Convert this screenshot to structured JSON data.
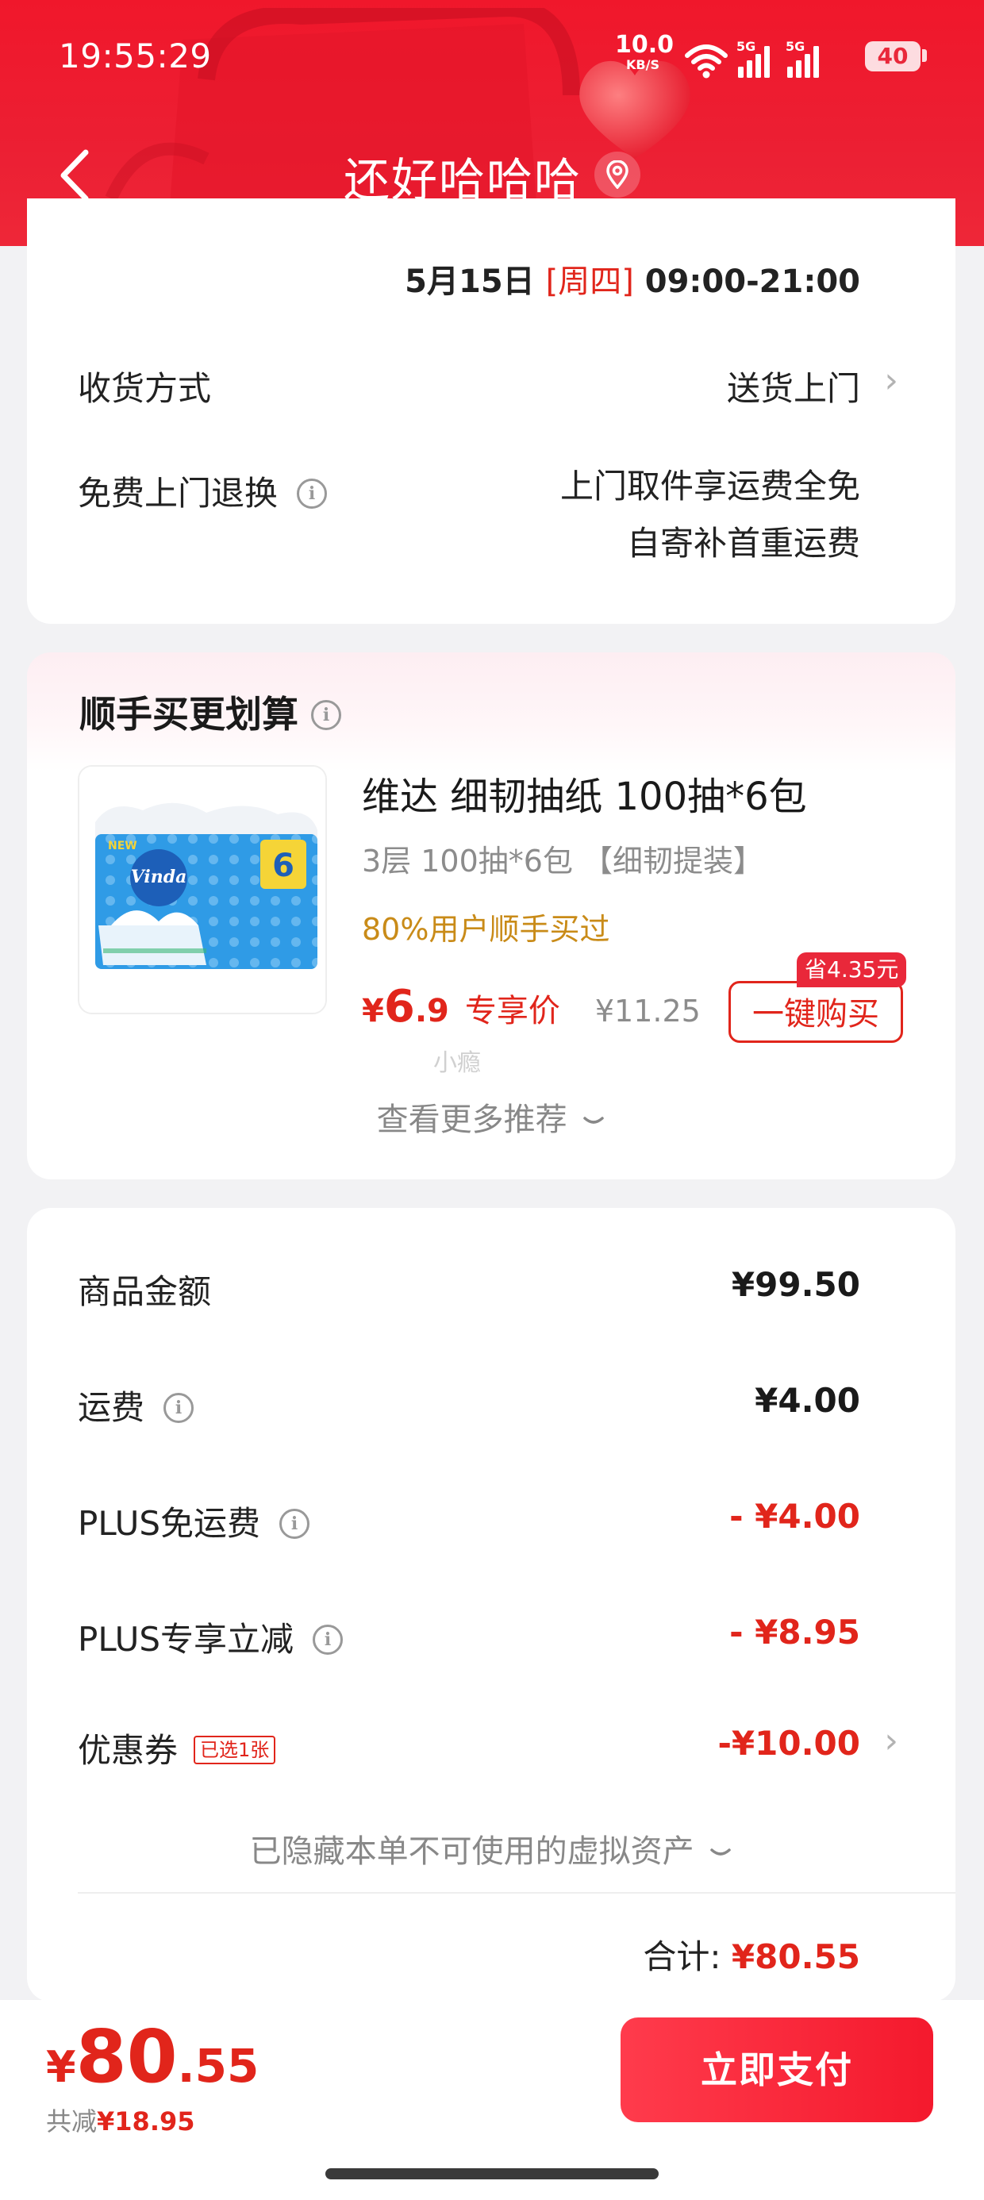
{
  "status_bar": {
    "time": "19:55:29",
    "net_speed": "10.0",
    "net_unit": "KB/S",
    "network_1": "5G",
    "network_2": "5G",
    "battery": "40"
  },
  "header": {
    "title": "还好哈哈哈",
    "back_icon": "chevron-left-icon",
    "location_icon": "location-pin-icon"
  },
  "delivery": {
    "date": "5月15日",
    "weekday": "[周四]",
    "hours": "09:00-21:00",
    "method_label": "收货方式",
    "method_value": "送货上门",
    "return_label": "免费上门退换",
    "return_value_line1": "上门取件享运费全免",
    "return_value_line2": "自寄补首重运费"
  },
  "recommend": {
    "title": "顺手买更划算",
    "product_name": "维达 细韧抽纸 100抽*6包",
    "product_spec": "3层 100抽*6包 【细韧提装】",
    "social_proof": "80%用户顺手买过",
    "price_currency": "¥",
    "price_int": "6",
    "price_dec": ".9",
    "price_tag": "专享价",
    "original_price": "¥11.25",
    "buy_button": "一键购买",
    "save_badge": "省4.35元",
    "watermark": "小瘾",
    "more_link": "查看更多推荐"
  },
  "fees": {
    "items": [
      {
        "label": "商品金额",
        "value": "¥99.50"
      },
      {
        "label": "运费",
        "value": "¥4.00"
      },
      {
        "label": "PLUS免运费",
        "value": "- ¥4.00"
      },
      {
        "label": "PLUS专享立减",
        "value": "- ¥8.95"
      },
      {
        "label": "优惠券",
        "value": "-¥10.00",
        "badge": "已选1张"
      }
    ],
    "hidden_assets": "已隐藏本单不可使用的虚拟资产",
    "total_label": "合计:",
    "total_value": "¥80.55"
  },
  "bottom": {
    "currency": "¥",
    "total_int": "80",
    "total_dec": ".55",
    "saved_label": "共减",
    "saved_value": "¥18.95",
    "pay_button": "立即支付"
  },
  "colors": {
    "brand_red": "#e9283a",
    "price_red": "#e1251b",
    "social_gold": "#c98b18"
  }
}
